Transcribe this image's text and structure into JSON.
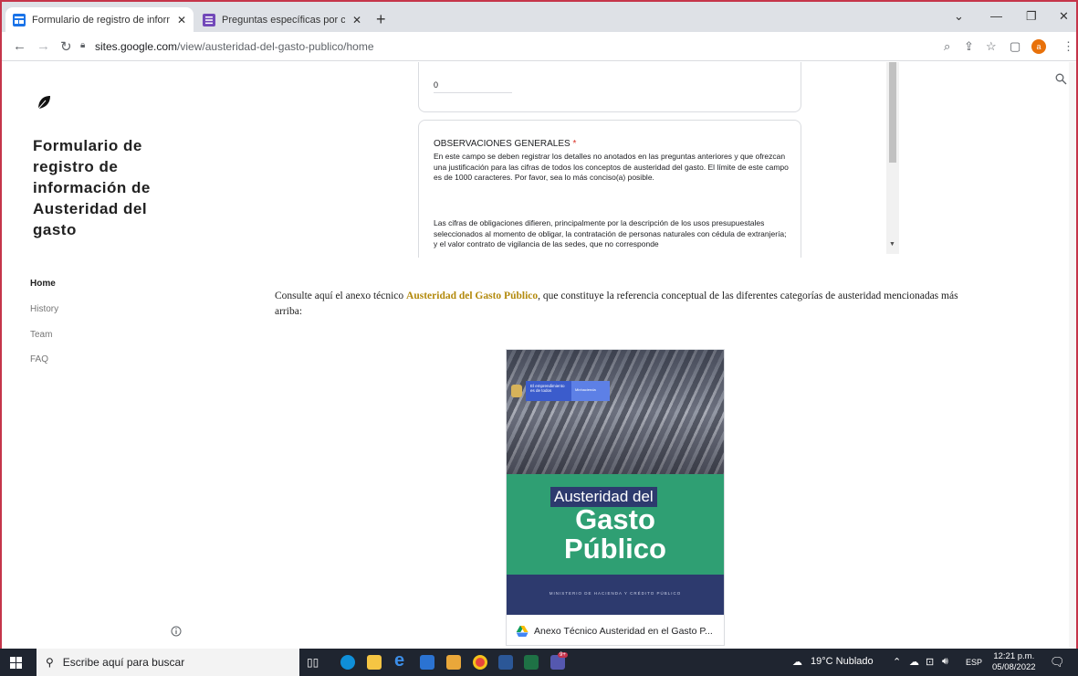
{
  "browser": {
    "tabs": [
      {
        "title": "Formulario de registro de inform",
        "active": true
      },
      {
        "title": "Preguntas específicas por concep",
        "active": false
      }
    ],
    "url_host": "sites.google.com",
    "url_path": "/view/austeridad-del-gasto-publico/home",
    "profile_initial": "a"
  },
  "site": {
    "title": "Formulario de registro de información de Austeridad del gasto",
    "nav": [
      "Home",
      "History",
      "Team",
      "FAQ"
    ],
    "active_nav": "Home"
  },
  "form": {
    "previous_answer": "0",
    "question_title": "OBSERVACIONES GENERALES",
    "required_mark": "*",
    "question_description": "En este campo se deben registrar los detalles no anotados en las preguntas anteriores y que ofrezcan una justificación para las cifras de todos los conceptos de austeridad del gasto. El límite de este campo es de 1000 caracteres. Por favor, sea lo más conciso(a) posible.",
    "answer_text": "Las cifras de obligaciones difieren, principalmente por la descripción de los usos presupuestales seleccionados al momento de obligar, la contratación de personas naturales con cédula de extranjería; y el valor contrato de vigilancia de las sedes, que no corresponde"
  },
  "body": {
    "consult_before": "Consulte aquí el anexo técnico ",
    "consult_link": "Austeridad del Gasto Público",
    "consult_after": ", que constituye la referencia conceptual de las diferentes categorías de austeridad mencionadas más arriba:"
  },
  "document": {
    "cover_badge_1": "El emprendimiento es de todos",
    "cover_badge_2": "Minhacienda",
    "cover_title_1": "Austeridad del",
    "cover_title_2": "Gasto",
    "cover_title_3": "Público",
    "cover_ministry": "MINISTERIO DE HACIENDA Y CRÉDITO PÚBLICO",
    "file_name": "Anexo Técnico Austeridad en el Gasto P..."
  },
  "taskbar": {
    "search_placeholder": "Escribe aquí para buscar",
    "weather": "19°C  Nublado",
    "language": "ESP",
    "time": "12:21 p.m.",
    "date": "05/08/2022",
    "teams_badge": "9+"
  },
  "colors": {
    "frame": "#c5354a",
    "link": "#b38a0d",
    "cover_green": "#2f9f73",
    "cover_navy": "#2d3a6e"
  }
}
